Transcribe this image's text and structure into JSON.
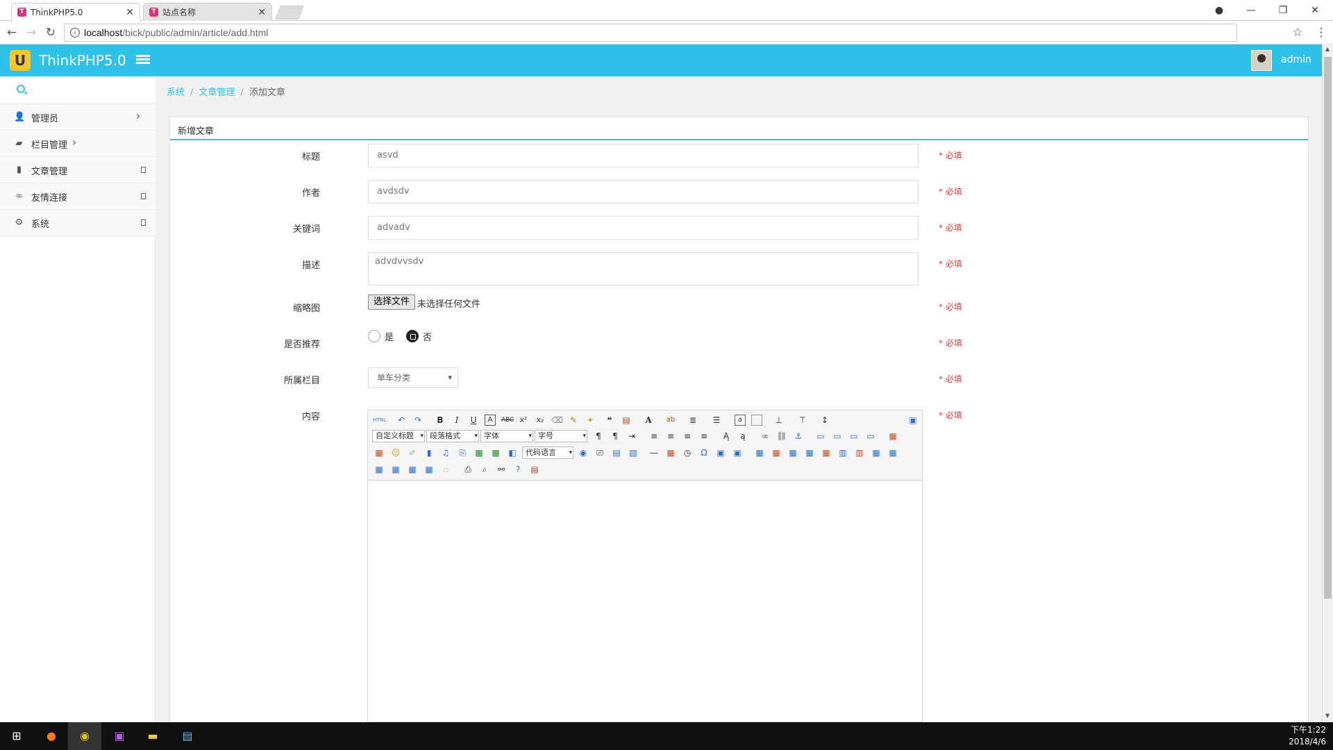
{
  "browser": {
    "tabs": [
      {
        "title": "ThinkPHP5.0",
        "active": true
      },
      {
        "title": "站点名称",
        "active": false
      }
    ],
    "url_host": "localhost",
    "url_path": "/bick/public/admin/article/add.html",
    "window_controls": [
      "minimize",
      "restore",
      "close"
    ]
  },
  "header": {
    "brand": "ThinkPHP5.0",
    "logo_glyph": "U",
    "username": "admin",
    "color": "#2ec2e8"
  },
  "sidebar": {
    "items": [
      {
        "label": "管理员",
        "icon": "user-icon"
      },
      {
        "label": "栏目管理",
        "icon": "folder-icon"
      },
      {
        "label": "文章管理",
        "icon": "book-icon"
      },
      {
        "label": "友情连接",
        "icon": "link-icon"
      },
      {
        "label": "系统",
        "icon": "gear-icon"
      }
    ]
  },
  "breadcrumb": [
    "系统",
    "文章管理",
    "添加文章"
  ],
  "panel": {
    "title": "新增文章",
    "fields": {
      "title": {
        "label": "标题",
        "value": "asvd"
      },
      "author": {
        "label": "作者",
        "value": "avdsdv"
      },
      "keywords": {
        "label": "关键词",
        "value": "advadv"
      },
      "description": {
        "label": "描述",
        "value": "advdvvsdv"
      },
      "thumbnail": {
        "label": "缩略图",
        "button": "选择文件",
        "status": "未选择任何文件"
      },
      "recommend": {
        "label": "是否推荐",
        "options": [
          "是",
          "否"
        ],
        "selected": "否"
      },
      "category": {
        "label": "所属栏目",
        "value": "单车分类"
      },
      "content": {
        "label": "内容"
      }
    },
    "required_text": "* 必填"
  },
  "editor": {
    "selects": [
      "自定义标题",
      "段落格式",
      "字体",
      "字号",
      "代码语言"
    ],
    "html_label": "HTML"
  },
  "taskbar": {
    "time": "下午1:22",
    "date": "2018/4/6"
  }
}
